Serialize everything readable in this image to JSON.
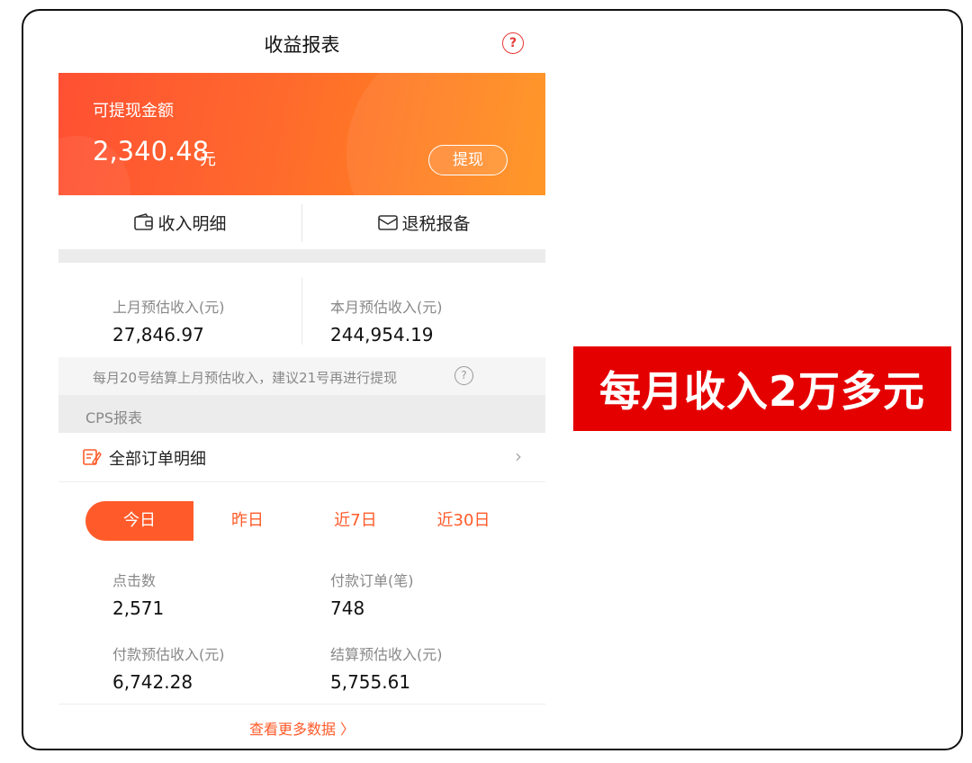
{
  "header": {
    "title": "收益报表",
    "help_icon": "question-circle-icon",
    "help_glyph": "?"
  },
  "balance": {
    "label": "可提现金额",
    "amount": "2,340.48",
    "unit": "元",
    "withdraw_label": "提现"
  },
  "quick_links": [
    {
      "label": "收入明细",
      "icon": "wallet-icon"
    },
    {
      "label": "退税报备",
      "icon": "envelope-icon"
    }
  ],
  "month_stats": [
    {
      "label": "上月预估收入(元)",
      "value": "27,846.97"
    },
    {
      "label": "本月预估收入(元)",
      "value": "244,954.19"
    }
  ],
  "notice": {
    "text": "每月20号结算上月预估收入，建议21号再进行提现",
    "help_glyph": "?"
  },
  "cps": {
    "section_title": "CPS报表",
    "orders_link": {
      "label": "全部订单明细",
      "icon": "edit-note-icon",
      "chevron": "›"
    },
    "periods": [
      {
        "label": "今日",
        "active": true
      },
      {
        "label": "昨日",
        "active": false
      },
      {
        "label": "近7日",
        "active": false
      },
      {
        "label": "近30日",
        "active": false
      }
    ],
    "stats": [
      {
        "label": "点击数",
        "value": "2,571"
      },
      {
        "label": "付款订单(笔)",
        "value": "748"
      },
      {
        "label": "付款预估收入(元)",
        "value": "6,742.28"
      },
      {
        "label": "结算预估收入(元)",
        "value": "5,755.61"
      }
    ],
    "more_label": "查看更多数据 〉"
  },
  "banner": {
    "text": "每月收入2万多元"
  },
  "colors": {
    "accent": "#ff5b2a",
    "card_start": "#ff5033",
    "card_end": "#ff9019",
    "banner_bg": "#e50000"
  }
}
